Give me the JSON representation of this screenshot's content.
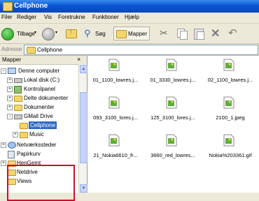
{
  "window": {
    "title": "Cellphone"
  },
  "menu": [
    "Filer",
    "Rediger",
    "Vis",
    "Foretrukne",
    "Funktioner",
    "Hjælp"
  ],
  "toolbar": {
    "back": "Tilbage",
    "search": "Søg",
    "folders": "Mapper"
  },
  "address": {
    "label": "Adresse",
    "value": "Cellphone"
  },
  "tree": {
    "header": "Mapper",
    "items": [
      {
        "label": "Denne computer"
      },
      {
        "label": "Lokal disk (C:)"
      },
      {
        "label": "Kontrolpanel"
      },
      {
        "label": "Delte dokumenter"
      },
      {
        "label": "Dokumenter"
      },
      {
        "label": "GMail Drive"
      },
      {
        "label": "Cellphone"
      },
      {
        "label": "Music"
      },
      {
        "label": "Netværkssteder"
      },
      {
        "label": "Papirkurv"
      },
      {
        "label": "HenGemt"
      },
      {
        "label": "Netdrive"
      },
      {
        "label": "Views"
      }
    ]
  },
  "files": [
    {
      "name": "01_1100_lowres.j..."
    },
    {
      "name": "01_3330_lowres.j..."
    },
    {
      "name": "02_1100_lowres.j..."
    },
    {
      "name": "093_3100_lores.j..."
    },
    {
      "name": "125_3100_lores.j..."
    },
    {
      "name": "2100_1.jpeg"
    },
    {
      "name": "21_Nokia6610_fr..."
    },
    {
      "name": "3660_red_lowres..."
    },
    {
      "name": "Nokia%203361.gif"
    }
  ],
  "colors": {
    "title_bar": "#0a55d4",
    "highlight_box": "#c8102e",
    "selection": "#316ac5"
  }
}
